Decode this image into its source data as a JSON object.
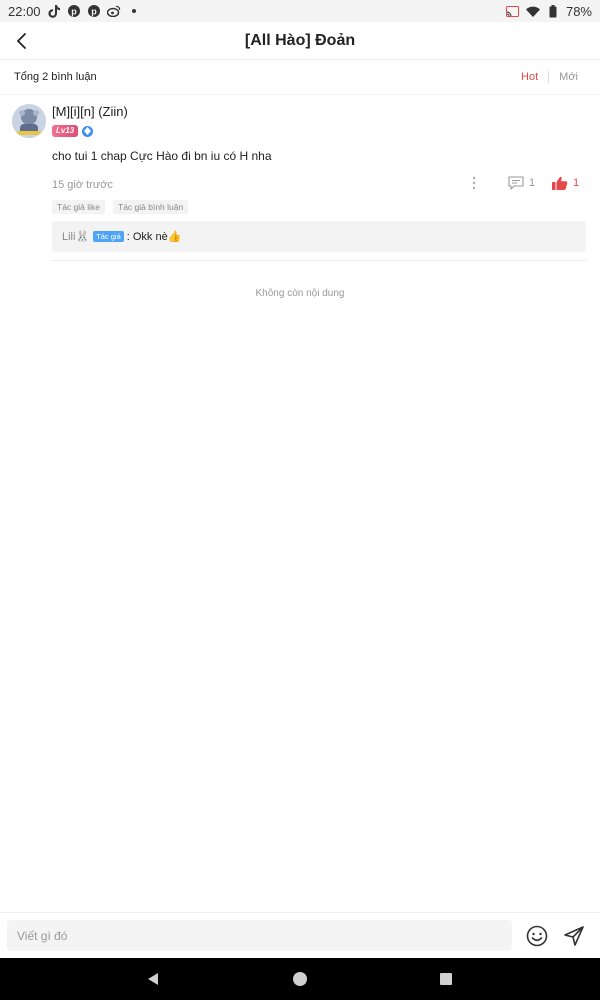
{
  "status_bar": {
    "time": "22:00",
    "battery": "78%",
    "left_icons": [
      "tiktok-icon",
      "pinterest-icon",
      "pinterest-icon",
      "weibo-icon",
      "dot-icon"
    ],
    "right_icons": [
      "cast-icon",
      "wifi-icon",
      "battery-icon"
    ]
  },
  "header": {
    "title": "[All Hào] Đoản",
    "back_icon": "back-arrow-icon"
  },
  "sub_header": {
    "total": "Tổng 2 bình luận",
    "sort_hot": "Hot",
    "sort_new": "Mới"
  },
  "comment": {
    "username": "[M][i][n] (Ziin)",
    "level": "Lv13",
    "content": "cho tui 1 chap Cực Hào đi bn iu có H nha",
    "time": "15 giờ trước",
    "reply_count": "1",
    "like_count": "1",
    "tags": [
      "Tác giả like",
      "Tác giả bình luận"
    ],
    "reply": {
      "user": "Lili🐰",
      "badge": "Tác giả",
      "text": ": Okk nè👍"
    }
  },
  "end_text": "Không còn nội dung",
  "input": {
    "placeholder": "Viết gì đó"
  },
  "colors": {
    "accent": "#e4494a",
    "author_badge": "#4ea4f5",
    "level_badge": "#e04b72"
  }
}
